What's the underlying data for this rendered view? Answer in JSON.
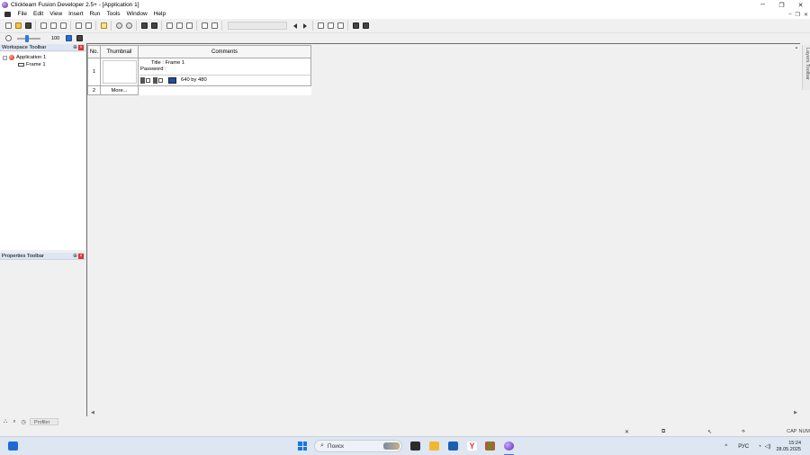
{
  "window": {
    "title": "Clickteam Fusion Developer 2.5+ - [Application 1]",
    "minimize": "─",
    "maximize": "❐",
    "close": "✕"
  },
  "menu": {
    "items": [
      "File",
      "Edit",
      "View",
      "Insert",
      "Run",
      "Tools",
      "Window",
      "Help"
    ],
    "mdi": {
      "minimize": "–",
      "restore": "❐",
      "close": "✕"
    }
  },
  "toolbar": {
    "zoom_value": "100"
  },
  "workspace": {
    "header": "Workspace Toolbar",
    "pin": "⊕",
    "close": "×",
    "tree": {
      "application": "Application 1",
      "frame": "Frame 1",
      "expander": "−"
    }
  },
  "properties": {
    "header": "Properties Toolbar",
    "pin": "⊕",
    "close": "×"
  },
  "bottom_tabs": {
    "profiler": "Profiler"
  },
  "frame_editor": {
    "columns": [
      "No.",
      "Thumbnail",
      "Comments"
    ],
    "rows": [
      {
        "no": "1",
        "title": "Title : Frame 1",
        "password": "Password :",
        "size": "640 by 480"
      },
      {
        "no": "2",
        "more": "More..."
      }
    ]
  },
  "layers_toolbar": "Layers Toolbar",
  "statusbar": {
    "caps": "CAP",
    "num": "NUM"
  },
  "taskbar": {
    "search_placeholder": "Поиск",
    "lang": "РУС",
    "time": "15:24",
    "date": "28.05.2025",
    "tray_expand": "^"
  },
  "colors": {
    "accent_blue": "#2f7bd8",
    "close_red": "#d9362b",
    "panel_header": "#dde6f2"
  }
}
